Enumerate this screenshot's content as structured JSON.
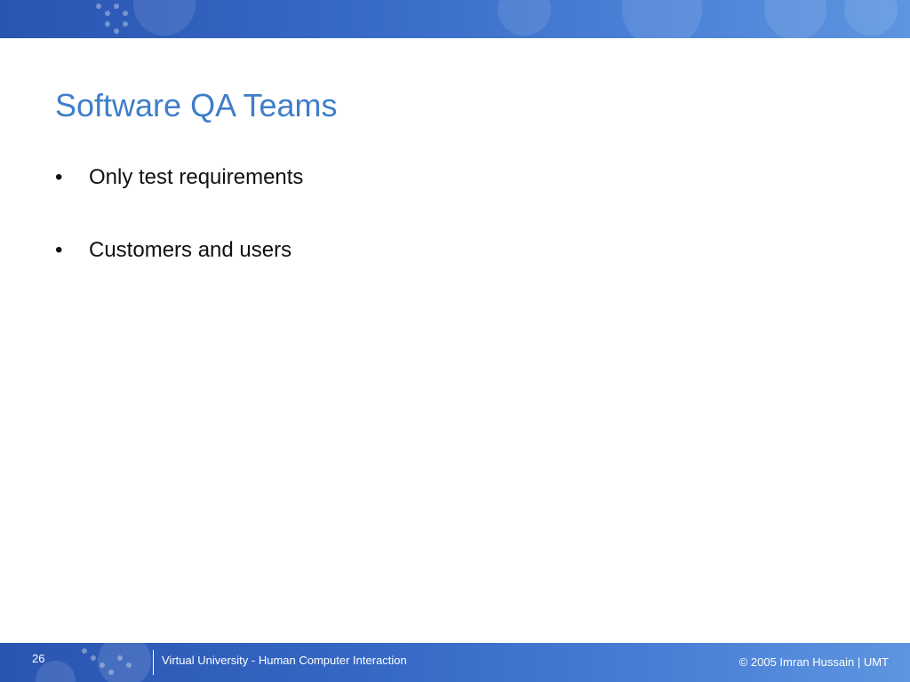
{
  "slide": {
    "title": "Software QA Teams",
    "bullets": [
      {
        "marker": "•",
        "text": "Only test requirements"
      },
      {
        "marker": "•",
        "text": "Customers and users"
      }
    ]
  },
  "footer": {
    "page_number": "26",
    "course": "Virtual University - Human Computer Interaction",
    "copyright": "© 2005 Imran Hussain | UMT"
  },
  "colors": {
    "title": "#3f7ec9",
    "banner_start": "#2a55b0",
    "banner_end": "#5e95e0",
    "body_text": "#111111"
  }
}
